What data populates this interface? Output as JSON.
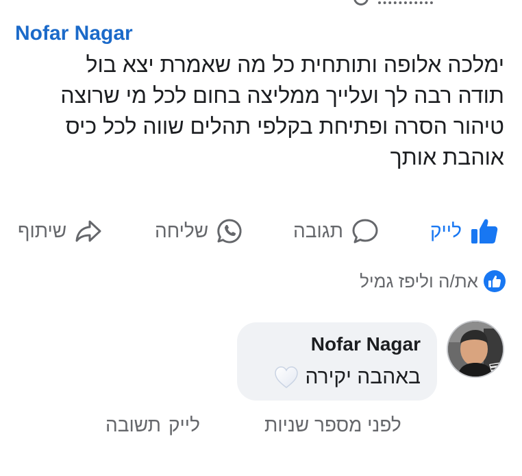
{
  "post": {
    "author": "Nofar Nagar",
    "lines": [
      "ימלכה אלופה ותותחית כל מה שאמרת יצא בול",
      "תודה רבה לך ועלייך ממליצה בחום לכל מי שרוצה",
      "טיהור הסרה ופתיחת בקלפי תהלים שווה לכל כיס",
      "אוהבת אותך"
    ]
  },
  "actions": {
    "like": "לייק",
    "comment": "תגובה",
    "send": "שליחה",
    "share": "שיתוף"
  },
  "reactions": {
    "text": "את/ה וליפז גמיל",
    "icon": "like-icon"
  },
  "comment": {
    "author": "Nofar Nagar",
    "text": "באהבה יקירה",
    "emoji": "white-heart-icon",
    "time": "לפני מספר שניות",
    "like_label": "לייק",
    "reply_label": "תשובה"
  },
  "colors": {
    "accent": "#1877f2",
    "author_link": "#1b6ac9",
    "secondary_text": "#65676b",
    "bubble_bg": "#f0f2f5"
  }
}
